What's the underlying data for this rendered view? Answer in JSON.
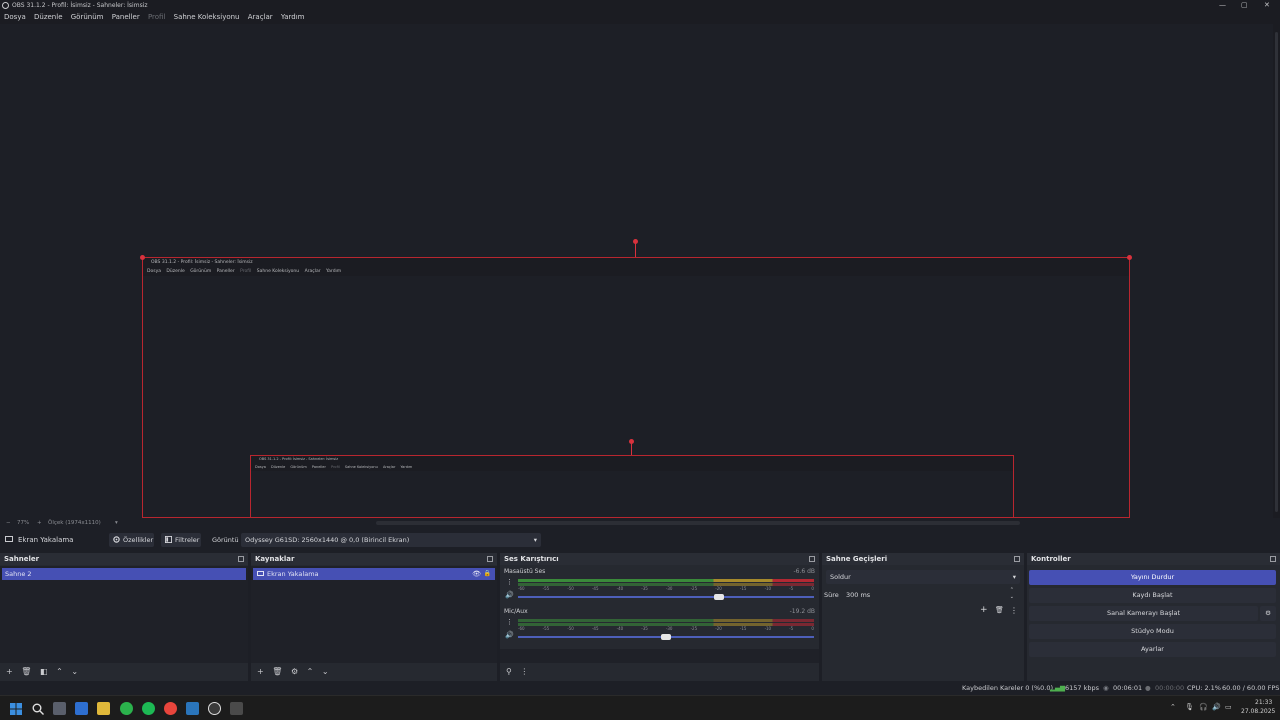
{
  "window": {
    "title": "OBS 31.1.2 - Profil: İsimsiz - Sahneler: İsimsiz",
    "controls": {
      "minimize": "—",
      "maximize": "▢",
      "close": "✕"
    }
  },
  "menu": {
    "items": [
      {
        "label": "Dosya",
        "disabled": false
      },
      {
        "label": "Düzenle",
        "disabled": false
      },
      {
        "label": "Görünüm",
        "disabled": false
      },
      {
        "label": "Paneller",
        "disabled": false
      },
      {
        "label": "Profil",
        "disabled": true
      },
      {
        "label": "Sahne Koleksiyonu",
        "disabled": false
      },
      {
        "label": "Araçlar",
        "disabled": false
      },
      {
        "label": "Yardım",
        "disabled": false
      }
    ]
  },
  "preview": {
    "nested_title": "OBS 31.1.2 - Profil: İsimsiz - Sahneler: İsimsiz"
  },
  "zoom": {
    "minus": "−",
    "level": "77%",
    "plus": "+",
    "base": "Ölçek (1974x1110)",
    "dropdown": "▾"
  },
  "source_toolbar": {
    "source_name": "Ekran Yakalama",
    "properties_label": "Özellikler",
    "filters_label": "Filtreler",
    "display_label": "Görüntü",
    "display_value": "Odyssey G61SD: 2560x1440 @ 0,0 (Birincil Ekran)"
  },
  "scenes": {
    "title": "Sahneler",
    "items": [
      {
        "label": "Sahne 2",
        "selected": true
      }
    ]
  },
  "sources": {
    "title": "Kaynaklar",
    "items": [
      {
        "label": "Ekran Yakalama",
        "selected": true
      }
    ]
  },
  "mixer": {
    "title": "Ses Karıştırıcı",
    "ticks": [
      "-60",
      "-55",
      "-50",
      "-45",
      "-40",
      "-35",
      "-30",
      "-25",
      "-20",
      "-15",
      "-10",
      "-5",
      "0"
    ],
    "channels": [
      {
        "name": "Masaüstü Ses",
        "db": "-6.6 dB",
        "volume": 0.68
      },
      {
        "name": "Mic/Aux",
        "db": "-19.2 dB",
        "volume": 0.5
      }
    ]
  },
  "transitions": {
    "title": "Sahne Geçişleri",
    "selected": "Soldur",
    "duration_label": "Süre",
    "duration_value": "300 ms"
  },
  "controls": {
    "title": "Kontroller",
    "stop_stream": "Yayını Durdur",
    "start_recording": "Kaydı Başlat",
    "start_virtual_cam": "Sanal Kamerayı Başlat",
    "studio_mode": "Stüdyo Modu",
    "settings": "Ayarlar"
  },
  "status": {
    "dropped_frames": "Kaybedilen Kareler 0 (%0.0)",
    "bitrate": "6157 kbps",
    "stream_time": "00:06:01",
    "rec_time": "00:00:00",
    "cpu": "CPU: 2.1%",
    "fps": "60.00 / 60.00 FPS"
  },
  "taskbar": {
    "time": "21:33",
    "date": "27.08.2025"
  },
  "colors": {
    "accent": "#4650b4",
    "selection_border": "#d8323d",
    "panel_bg": "#262930"
  }
}
